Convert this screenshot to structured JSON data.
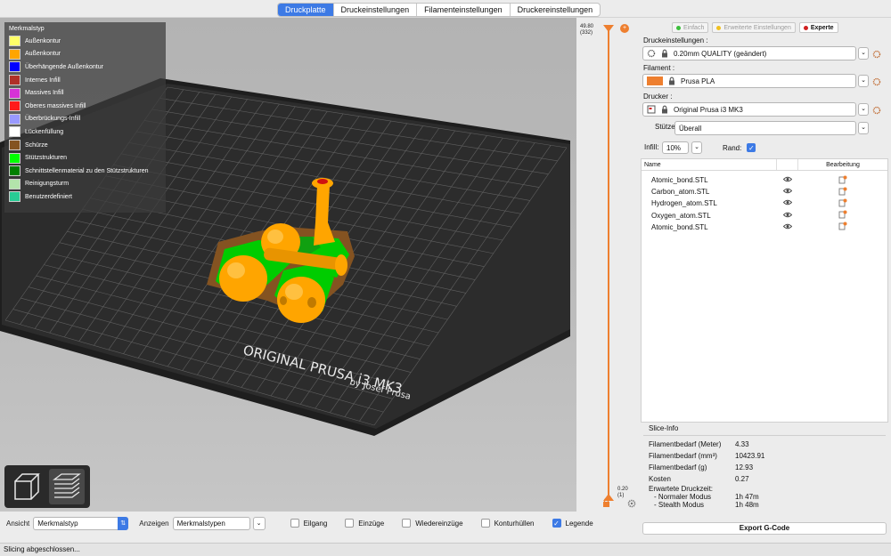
{
  "tabs": [
    "Druckplatte",
    "Druckeinstellungen",
    "Filamenteinstellungen",
    "Druckereinstellungen"
  ],
  "active_tab": 0,
  "legend": {
    "title": "Merkmalstyp",
    "items": [
      {
        "label": "Außenkontur",
        "color": "#ffff68"
      },
      {
        "label": "Außenkontur",
        "color": "#ffa500"
      },
      {
        "label": "Überhängende Außenkontur",
        "color": "#0000ff"
      },
      {
        "label": "Internes Infill",
        "color": "#b03029"
      },
      {
        "label": "Massives Infill",
        "color": "#d732d7"
      },
      {
        "label": "Oberes massives Infill",
        "color": "#ff1a1a"
      },
      {
        "label": "Überbrückungs-Infill",
        "color": "#9999ff"
      },
      {
        "label": "Lückenfüllung",
        "color": "#ffffff"
      },
      {
        "label": "Schürze",
        "color": "#845321"
      },
      {
        "label": "Stützstrukturen",
        "color": "#00ff00"
      },
      {
        "label": "Schnittstellenmaterial zu den Stützstrukturen",
        "color": "#008000"
      },
      {
        "label": "Reinigungsturm",
        "color": "#b3e3ab"
      },
      {
        "label": "Benutzerdefiniert",
        "color": "#28cc94"
      }
    ]
  },
  "bed": {
    "line1": "ORIGINAL PRUSA i3  MK3",
    "line2": "by Josef Prusa"
  },
  "layer_slider": {
    "top_value": "49.80",
    "top_layer": "(332)",
    "bottom_value": "0.20",
    "bottom_layer": "(1)",
    "accent": "#ee7f2f"
  },
  "bottom_bar": {
    "view_label": "Ansicht",
    "view_value": "Merkmalstyp",
    "show_label": "Anzeigen",
    "show_value": "Merkmalstypen",
    "checkboxes": [
      {
        "label": "Eilgang",
        "checked": false
      },
      {
        "label": "Einzüge",
        "checked": false
      },
      {
        "label": "Wiedereinzüge",
        "checked": false
      },
      {
        "label": "Konturhüllen",
        "checked": false
      },
      {
        "label": "Legende",
        "checked": true
      }
    ]
  },
  "status": "Slicing abgeschlossen...",
  "modes": [
    {
      "label": "Einfach",
      "color": "#3cbf3c"
    },
    {
      "label": "Erweiterte Einstellungen",
      "color": "#f0c020"
    },
    {
      "label": "Experte",
      "color": "#d02020"
    }
  ],
  "settings": {
    "print_label": "Druckeinstellungen :",
    "print_value": "0.20mm QUALITY (geändert)",
    "filament_label": "Filament :",
    "filament_value": "Prusa PLA",
    "filament_color": "#ee7f2f",
    "printer_label": "Drucker :",
    "printer_value": "Original Prusa i3 MK3",
    "supports_label": "Stützen:",
    "supports_value": "Überall",
    "infill_label": "Infill:",
    "infill_value": "10%",
    "brim_label": "Rand:"
  },
  "objects": {
    "col_name": "Name",
    "col_edit": "Bearbeitung",
    "items": [
      "Atomic_bond.STL",
      "Carbon_atom.STL",
      "Hydrogen_atom.STL",
      "Oxygen_atom.STL",
      "Atomic_bond.STL"
    ]
  },
  "slice_info": {
    "title": "Slice-Info",
    "rows": [
      {
        "k": "Filamentbedarf (Meter)",
        "v": "4.33"
      },
      {
        "k": "Filamentbedarf (mm³)",
        "v": "10423.91"
      },
      {
        "k": "Filamentbedarf (g)",
        "v": "12.93"
      },
      {
        "k": "Kosten",
        "v": "0.27"
      }
    ],
    "time_label": "Erwartete Druckzeit:",
    "normal_label": "- Normaler Modus",
    "normal_value": "1h 47m",
    "stealth_label": "- Stealth Modus",
    "stealth_value": "1h 48m"
  },
  "export_label": "Export G-Code"
}
